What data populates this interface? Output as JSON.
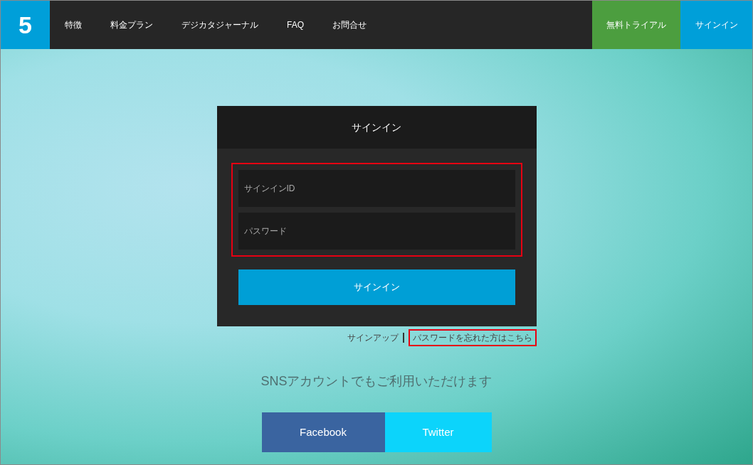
{
  "header": {
    "logo": "5",
    "nav": [
      "特徴",
      "料金プラン",
      "デジカタジャーナル",
      "FAQ",
      "お問合せ"
    ],
    "trial_button": "無料トライアル",
    "signin_button": "サインイン"
  },
  "signin_card": {
    "title": "サインイン",
    "fields": [
      {
        "placeholder": "サインインID"
      },
      {
        "placeholder": "パスワード"
      }
    ],
    "submit": "サインイン"
  },
  "links": {
    "signup": "サインアップ",
    "forgot_password": "パスワードを忘れた方はこちら"
  },
  "sns": {
    "caption": "SNSアカウントでもご利用いただけます",
    "buttons": [
      {
        "label": "Facebook",
        "color": "#3a64a0"
      },
      {
        "label": "Twitter",
        "color": "#0cd4fb"
      }
    ]
  }
}
